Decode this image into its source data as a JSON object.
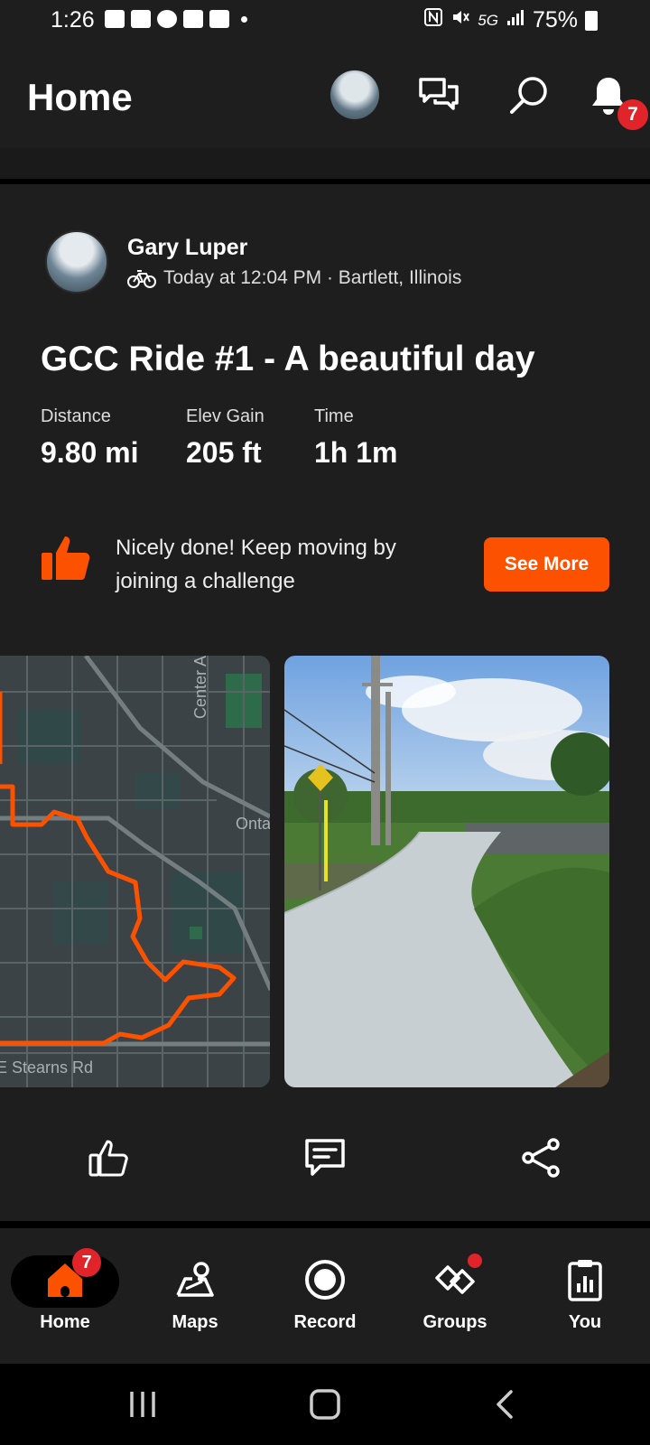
{
  "status_bar": {
    "time": "1:26",
    "network": "5G",
    "battery": "75%"
  },
  "header": {
    "title": "Home",
    "notification_count": "7"
  },
  "activity": {
    "athlete_name": "Gary Luper",
    "meta": "Today at 12:04 PM · Bartlett, Illinois",
    "title": "GCC Ride #1 - A beautiful day",
    "stats": [
      {
        "label": "Distance",
        "value": "9.80 mi"
      },
      {
        "label": "Elev Gain",
        "value": "205 ft"
      },
      {
        "label": "Time",
        "value": "1h 1m"
      }
    ],
    "map_labels": {
      "street_1": "Center A",
      "street_2": "Onta",
      "street_3": "E Stearns Rd"
    }
  },
  "promo": {
    "text": "Nicely done! Keep moving by joining a challenge",
    "button": "See More"
  },
  "bottom_nav": {
    "items": [
      {
        "label": "Home",
        "badge": "7"
      },
      {
        "label": "Maps"
      },
      {
        "label": "Record"
      },
      {
        "label": "Groups"
      },
      {
        "label": "You"
      }
    ]
  },
  "colors": {
    "accent": "#fc5200",
    "background": "#121212",
    "surface": "#1e1e1e",
    "badge": "#e0242a"
  }
}
